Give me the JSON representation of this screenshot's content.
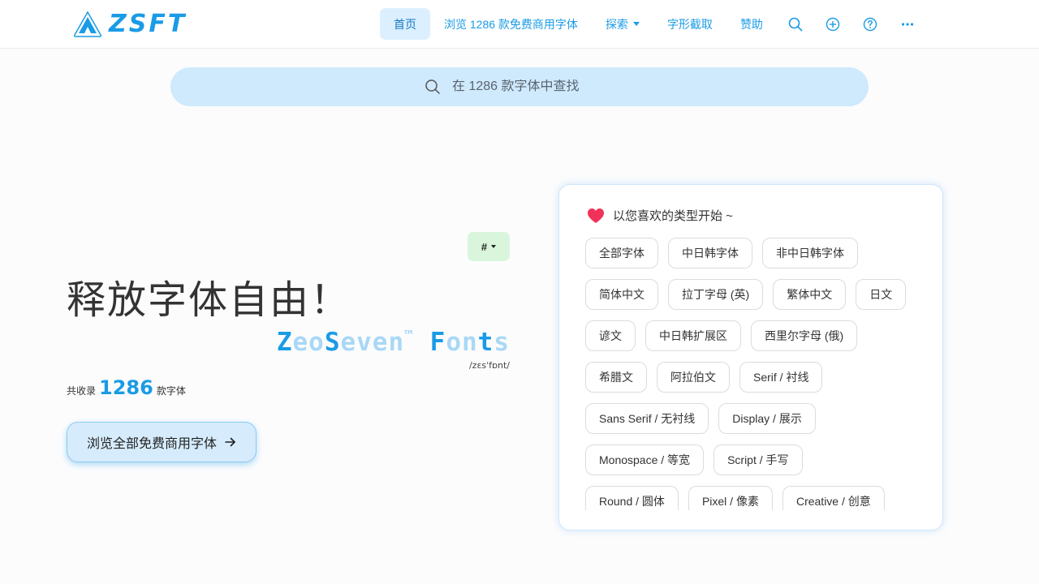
{
  "nav": {
    "logo_text": "ZSFT",
    "items": [
      {
        "label": "首页",
        "active": true
      },
      {
        "label": "浏览 1286 款免费商用字体"
      },
      {
        "label": "探索"
      },
      {
        "label": "字形截取"
      },
      {
        "label": "赞助"
      }
    ],
    "icons": [
      "search-icon",
      "plus-circle-icon",
      "question-circle-icon",
      "more-icon"
    ]
  },
  "search": {
    "placeholder": "在 1286 款字体中查找"
  },
  "hero": {
    "hash_label": "#",
    "headline": "释放字体自由！",
    "brand": {
      "parts": [
        "Z",
        "eo",
        "S",
        "even",
        "™",
        " ",
        "F",
        "on",
        "t",
        "s"
      ]
    },
    "phonetic": "/zɛsˈfɒnt/",
    "count_prefix": "共收录",
    "count": "1286",
    "count_suffix": "款字体",
    "cta_label": "浏览全部免费商用字体"
  },
  "panel": {
    "title": "以您喜欢的类型开始 ~",
    "rows": [
      [
        "全部字体",
        "中日韩字体",
        "非中日韩字体"
      ],
      [
        "简体中文",
        "拉丁字母 (英)",
        "繁体中文",
        "日文"
      ],
      [
        "谚文",
        "中日韩扩展区",
        "西里尔字母 (俄)"
      ],
      [
        "希腊文",
        "阿拉伯文",
        "Serif / 衬线"
      ],
      [
        "Sans Serif / 无衬线",
        "Display / 展示"
      ],
      [
        "Monospace / 等宽",
        "Script / 手写"
      ],
      [
        "Round / 圆体",
        "Pixel / 像素",
        "Creative / 创意"
      ]
    ]
  },
  "colors": {
    "accent": "#1a9be6",
    "accent_light": "#a9d8f6",
    "search_bg": "#cfe9fd",
    "heart": "#f0325a"
  }
}
